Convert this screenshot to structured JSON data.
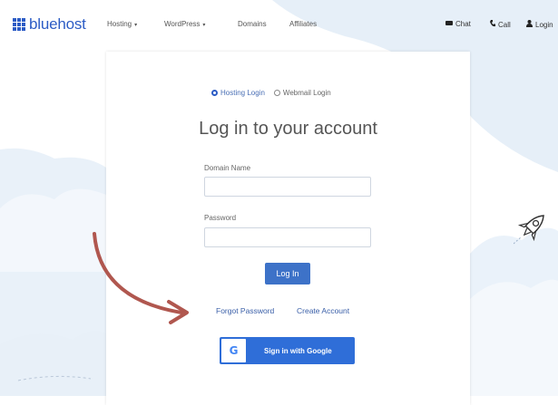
{
  "colors": {
    "brand": "#2c5cc5",
    "accent_button": "#3d72c8",
    "google_button": "#2f6ed8",
    "arrow": "#b0574f",
    "cloud": "#e8f1f9"
  },
  "header": {
    "logo_text": "bluehost",
    "nav": [
      {
        "label": "Hosting",
        "has_caret": true
      },
      {
        "label": "WordPress",
        "has_caret": true
      },
      {
        "label": "Domains",
        "has_caret": false
      },
      {
        "label": "Affiliates",
        "has_caret": false
      }
    ],
    "utility": [
      {
        "label": "Chat",
        "icon": "chat-icon"
      },
      {
        "label": "Call",
        "icon": "phone-icon"
      },
      {
        "label": "Login",
        "icon": "user-icon"
      }
    ]
  },
  "login": {
    "options": [
      {
        "label": "Hosting Login",
        "selected": true
      },
      {
        "label": "Webmail Login",
        "selected": false
      }
    ],
    "title": "Log in to your account",
    "domain_label": "Domain Name",
    "domain_value": "",
    "password_label": "Password",
    "password_value": "",
    "login_button": "Log In",
    "forgot_password": "Forgot Password",
    "create_account": "Create Account",
    "google_button": "Sign in with Google",
    "google_letter": "G"
  }
}
